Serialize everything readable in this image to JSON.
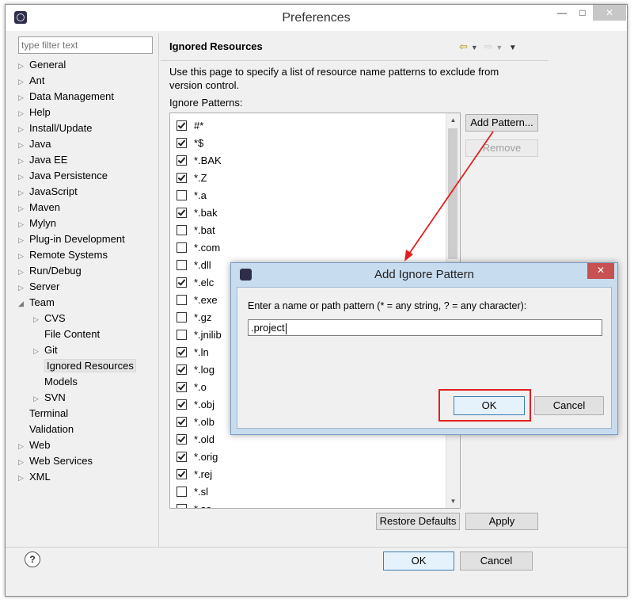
{
  "window": {
    "title": "Preferences"
  },
  "filter": {
    "placeholder": "type filter text"
  },
  "tree": [
    {
      "label": "General",
      "expandable": true
    },
    {
      "label": "Ant",
      "expandable": true
    },
    {
      "label": "Data Management",
      "expandable": true
    },
    {
      "label": "Help",
      "expandable": true
    },
    {
      "label": "Install/Update",
      "expandable": true
    },
    {
      "label": "Java",
      "expandable": true
    },
    {
      "label": "Java EE",
      "expandable": true
    },
    {
      "label": "Java Persistence",
      "expandable": true
    },
    {
      "label": "JavaScript",
      "expandable": true
    },
    {
      "label": "Maven",
      "expandable": true
    },
    {
      "label": "Mylyn",
      "expandable": true
    },
    {
      "label": "Plug-in Development",
      "expandable": true
    },
    {
      "label": "Remote Systems",
      "expandable": true
    },
    {
      "label": "Run/Debug",
      "expandable": true
    },
    {
      "label": "Server",
      "expandable": true
    },
    {
      "label": "Team",
      "expandable": true,
      "expanded": true
    },
    {
      "label": "CVS",
      "expandable": true,
      "child": true
    },
    {
      "label": "File Content",
      "child": true
    },
    {
      "label": "Git",
      "expandable": true,
      "child": true
    },
    {
      "label": "Ignored Resources",
      "child": true,
      "selected": true
    },
    {
      "label": "Models",
      "child": true
    },
    {
      "label": "SVN",
      "expandable": true,
      "child": true
    },
    {
      "label": "Terminal"
    },
    {
      "label": "Validation"
    },
    {
      "label": "Web",
      "expandable": true
    },
    {
      "label": "Web Services",
      "expandable": true
    },
    {
      "label": "XML",
      "expandable": true
    }
  ],
  "page": {
    "title": "Ignored Resources",
    "description": "Use this page to specify a list of resource name patterns to exclude from version control.",
    "patterns_label": "Ignore Patterns:"
  },
  "patterns": [
    {
      "text": "#*",
      "checked": true
    },
    {
      "text": "*$",
      "checked": true
    },
    {
      "text": "*.BAK",
      "checked": true
    },
    {
      "text": "*.Z",
      "checked": true
    },
    {
      "text": "*.a",
      "checked": false
    },
    {
      "text": "*.bak",
      "checked": true
    },
    {
      "text": "*.bat",
      "checked": false
    },
    {
      "text": "*.com",
      "checked": false
    },
    {
      "text": "*.dll",
      "checked": false
    },
    {
      "text": "*.elc",
      "checked": true
    },
    {
      "text": "*.exe",
      "checked": false
    },
    {
      "text": "*.gz",
      "checked": false
    },
    {
      "text": "*.jnilib",
      "checked": false
    },
    {
      "text": "*.ln",
      "checked": true
    },
    {
      "text": "*.log",
      "checked": true
    },
    {
      "text": "*.o",
      "checked": true
    },
    {
      "text": "*.obj",
      "checked": true
    },
    {
      "text": "*.olb",
      "checked": true
    },
    {
      "text": "*.old",
      "checked": true
    },
    {
      "text": "*.orig",
      "checked": true
    },
    {
      "text": "*.rej",
      "checked": true
    },
    {
      "text": "*.sl",
      "checked": false
    },
    {
      "text": "*.so",
      "checked": false
    }
  ],
  "buttons": {
    "add_pattern": "Add Pattern...",
    "remove": "Remove",
    "restore_defaults": "Restore Defaults",
    "apply": "Apply",
    "ok": "OK",
    "cancel": "Cancel",
    "help": "?"
  },
  "dialog": {
    "title": "Add Ignore Pattern",
    "prompt": "Enter a name or path pattern (* = any string, ? = any character):",
    "value": ".project",
    "ok": "OK",
    "cancel": "Cancel"
  },
  "colors": {
    "annotation": "#e02020"
  }
}
